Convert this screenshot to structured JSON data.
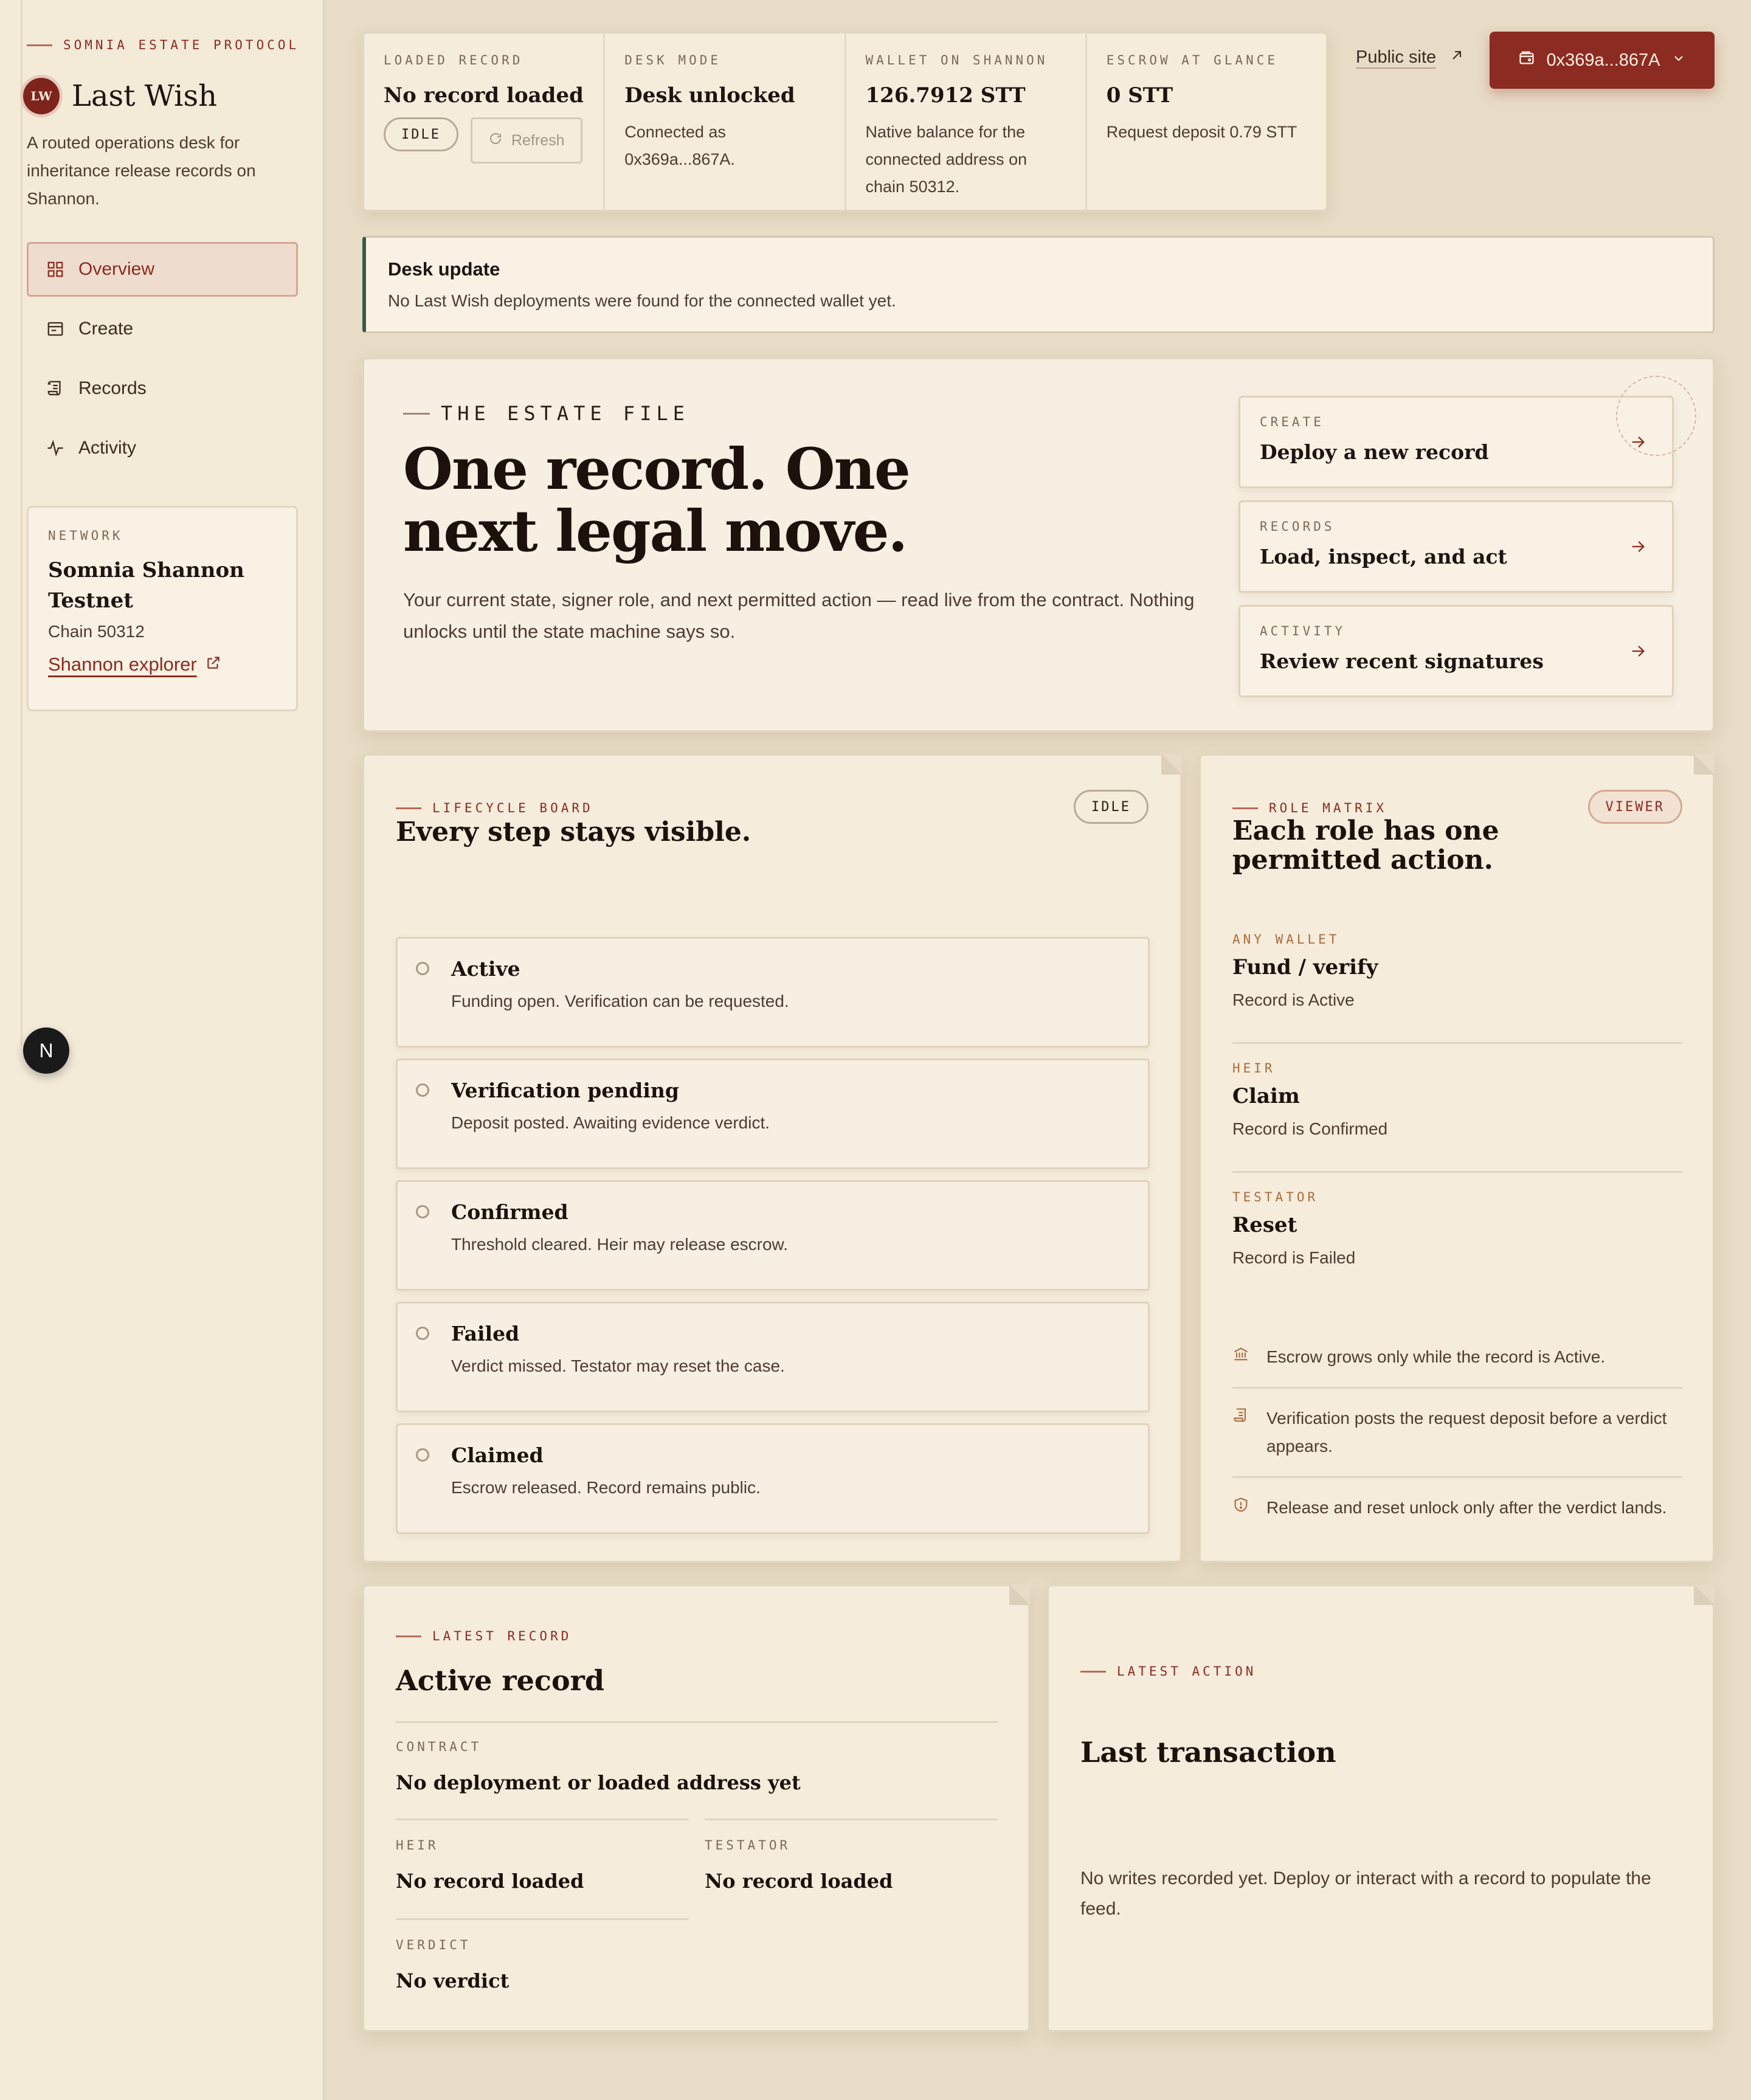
{
  "sidebar": {
    "protocol": "SOMNIA ESTATE PROTOCOL",
    "logo": "LW",
    "app_name": "Last Wish",
    "description": "A routed operations desk for inheritance release records on Shannon.",
    "nav": [
      {
        "label": "Overview",
        "icon": "grid-icon",
        "active": true
      },
      {
        "label": "Create",
        "icon": "card-icon",
        "active": false
      },
      {
        "label": "Records",
        "icon": "scroll-icon",
        "active": false
      },
      {
        "label": "Activity",
        "icon": "pulse-icon",
        "active": false
      }
    ],
    "network": {
      "label": "NETWORK",
      "name": "Somnia Shannon Testnet",
      "chain": "Chain 50312",
      "explorer": "Shannon explorer"
    },
    "badge": "N"
  },
  "stats": {
    "loaded": {
      "label": "LOADED RECORD",
      "value": "No record loaded",
      "pill": "IDLE",
      "refresh": "Refresh"
    },
    "desk": {
      "label": "DESK MODE",
      "value": "Desk unlocked",
      "sub": "Connected as 0x369a...867A."
    },
    "wallet": {
      "label": "WALLET ON SHANNON",
      "value": "126.7912 STT",
      "sub": "Native balance for the connected address on chain 50312."
    },
    "escrow": {
      "label": "ESCROW AT GLANCE",
      "value": "0 STT",
      "sub": "Request deposit 0.79 STT"
    }
  },
  "header": {
    "public_site": "Public site",
    "wallet": "0x369a...867A"
  },
  "update": {
    "title": "Desk update",
    "text": "No Last Wish deployments were found for the connected wallet yet."
  },
  "hero": {
    "eyebrow": "THE ESTATE FILE",
    "title": "One record. One next legal move.",
    "desc": "Your current state, signer role, and next permitted action — read live from the contract. Nothing unlocks until the state machine says so.",
    "links": [
      {
        "label": "CREATE",
        "title": "Deploy a new record"
      },
      {
        "label": "RECORDS",
        "title": "Load, inspect, and act"
      },
      {
        "label": "ACTIVITY",
        "title": "Review recent signatures"
      }
    ]
  },
  "lifecycle": {
    "eyebrow": "LIFECYCLE BOARD",
    "title": "Every step stays visible.",
    "badge": "IDLE",
    "steps": [
      {
        "title": "Active",
        "desc": "Funding open. Verification can be requested."
      },
      {
        "title": "Verification pending",
        "desc": "Deposit posted. Awaiting evidence verdict."
      },
      {
        "title": "Confirmed",
        "desc": "Threshold cleared. Heir may release escrow."
      },
      {
        "title": "Failed",
        "desc": "Verdict missed. Testator may reset the case."
      },
      {
        "title": "Claimed",
        "desc": "Escrow released. Record remains public."
      }
    ]
  },
  "roles": {
    "eyebrow": "ROLE MATRIX",
    "title": "Each role has one permitted action.",
    "badge": "VIEWER",
    "items": [
      {
        "label": "ANY WALLET",
        "title": "Fund / verify",
        "desc": "Record is Active"
      },
      {
        "label": "HEIR",
        "title": "Claim",
        "desc": "Record is Confirmed"
      },
      {
        "label": "TESTATOR",
        "title": "Reset",
        "desc": "Record is Failed"
      }
    ],
    "notes": [
      {
        "icon": "bank-icon",
        "text": "Escrow grows only while the record is Active."
      },
      {
        "icon": "scroll-icon",
        "text": "Verification posts the request deposit before a verdict appears."
      },
      {
        "icon": "shield-icon",
        "text": "Release and reset unlock only after the verdict lands."
      }
    ]
  },
  "latest_record": {
    "eyebrow": "LATEST RECORD",
    "title": "Active record",
    "contract_label": "CONTRACT",
    "contract": "No deployment or loaded address yet",
    "heir_label": "HEIR",
    "heir": "No record loaded",
    "testator_label": "TESTATOR",
    "testator": "No record loaded",
    "verdict_label": "VERDICT",
    "verdict": "No verdict"
  },
  "latest_action": {
    "eyebrow": "LATEST ACTION",
    "title": "Last transaction",
    "text": "No writes recorded yet. Deploy or interact with a record to populate the feed."
  },
  "colors": {
    "accent": "#8c2b21",
    "background": "#e8dcc6",
    "card": "#f5ecdc",
    "update_bar": "#355a48"
  }
}
